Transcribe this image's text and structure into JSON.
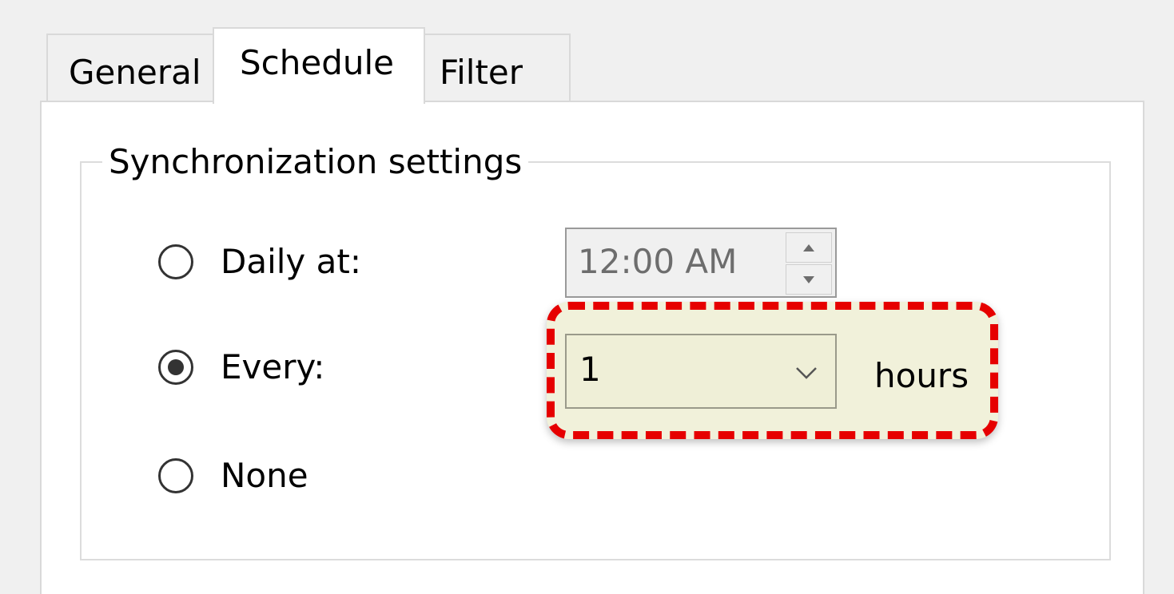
{
  "tabs": [
    {
      "label": "General",
      "selected": false
    },
    {
      "label": "Schedule",
      "selected": true
    },
    {
      "label": "Filter",
      "selected": false
    }
  ],
  "sync_settings": {
    "legend": "Synchronization settings",
    "options": [
      {
        "label": "Daily at:",
        "checked": false
      },
      {
        "label": "Every:",
        "checked": true
      },
      {
        "label": "None",
        "checked": false
      }
    ],
    "daily_time": {
      "value": "12:00 AM",
      "enabled": false
    },
    "every_hours": {
      "value": "1",
      "unit_label": "hours"
    }
  },
  "colors": {
    "highlight_border": "#e60000",
    "highlight_fill": "#f1f1da"
  },
  "icons": {
    "spin_up": "triangle-up-icon",
    "spin_down": "triangle-down-icon",
    "dropdown": "chevron-down-icon"
  }
}
